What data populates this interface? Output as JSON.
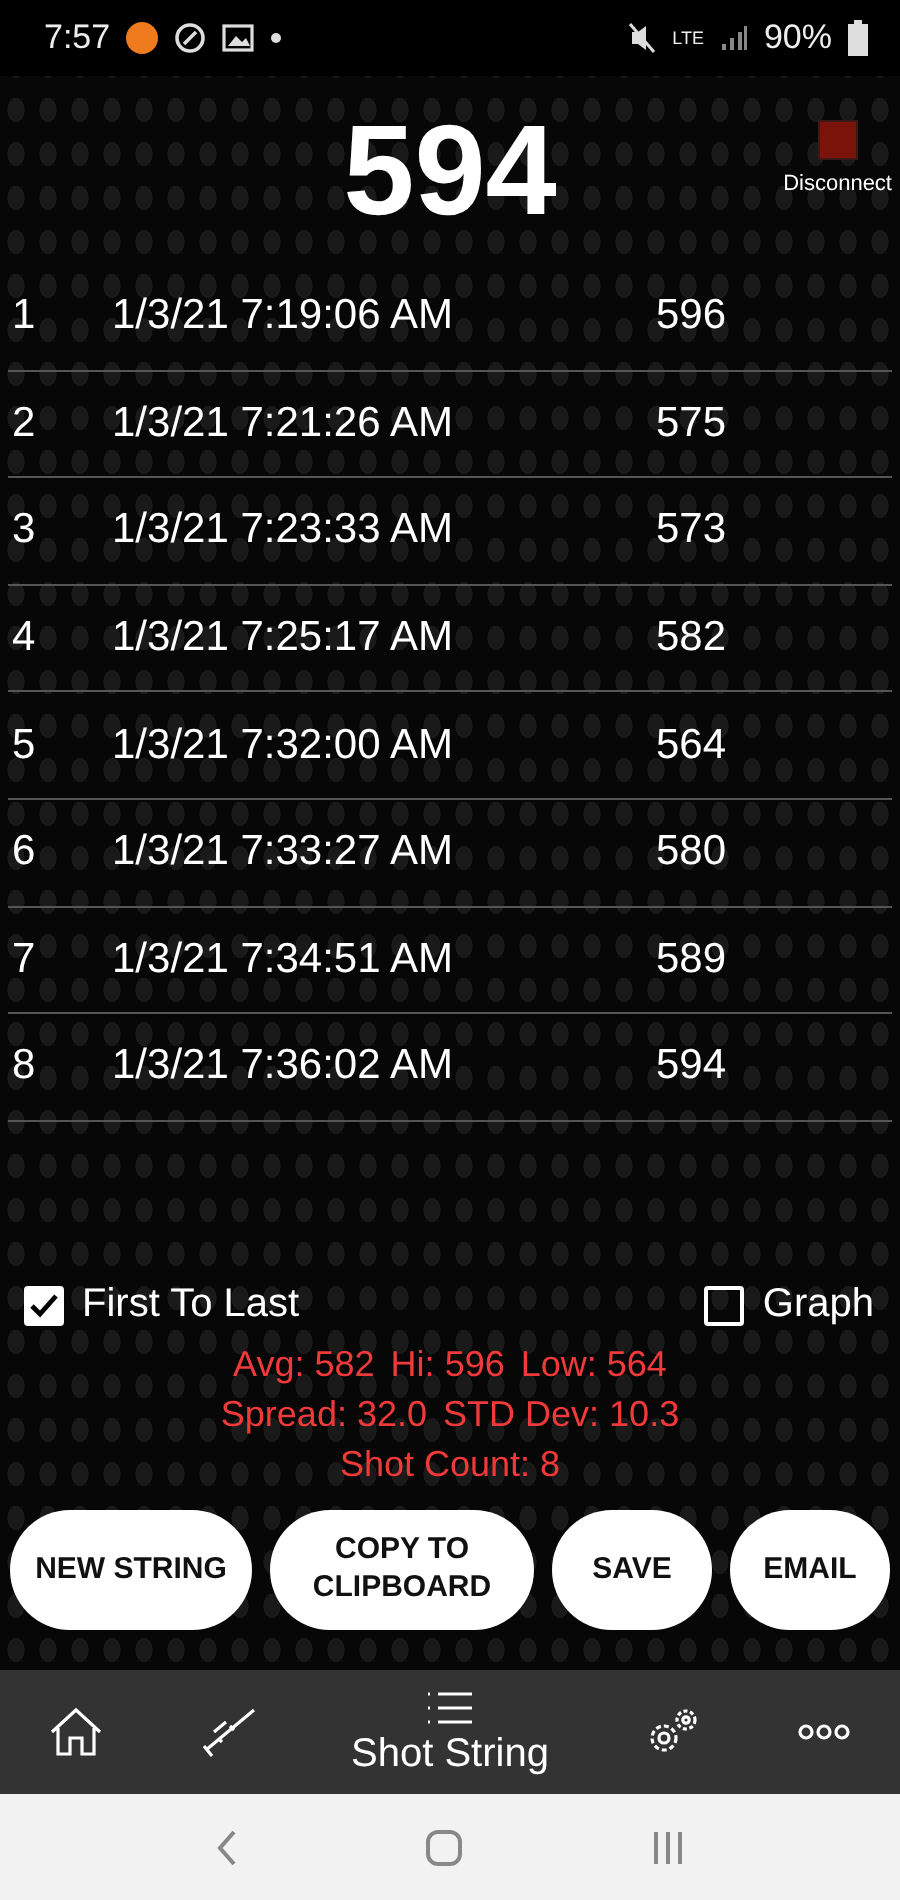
{
  "status_bar": {
    "time": "7:57",
    "network": "LTE",
    "battery": "90%"
  },
  "header": {
    "reading": "594",
    "disconnect": {
      "label": "Disconnect",
      "connected": true
    }
  },
  "shots": [
    {
      "index": "1",
      "time": "1/3/21 7:19:06 AM",
      "velocity": "596"
    },
    {
      "index": "2",
      "time": "1/3/21 7:21:26 AM",
      "velocity": "575"
    },
    {
      "index": "3",
      "time": "1/3/21 7:23:33 AM",
      "velocity": "573"
    },
    {
      "index": "4",
      "time": "1/3/21 7:25:17 AM",
      "velocity": "582"
    },
    {
      "index": "5",
      "time": "1/3/21 7:32:00 AM",
      "velocity": "564"
    },
    {
      "index": "6",
      "time": "1/3/21 7:33:27 AM",
      "velocity": "580"
    },
    {
      "index": "7",
      "time": "1/3/21 7:34:51 AM",
      "velocity": "589"
    },
    {
      "index": "8",
      "time": "1/3/21 7:36:02 AM",
      "velocity": "594"
    }
  ],
  "options": [
    {
      "label": "First To Last",
      "checked": true
    },
    {
      "label": "Graph",
      "checked": false
    }
  ],
  "stats": [
    [
      {
        "label": "Avg:",
        "value": "582"
      },
      {
        "label": "Hi:",
        "value": "596"
      },
      {
        "label": "Low:",
        "value": "564"
      }
    ],
    [
      {
        "label": "Spread:",
        "value": "32.0"
      },
      {
        "label": "STD Dev:",
        "value": "10.3"
      }
    ],
    [
      {
        "label": "Shot Count:",
        "value": "8"
      }
    ]
  ],
  "buttons": [
    {
      "label": "NEW STRING"
    },
    {
      "label": "COPY TO CLIPBOARD"
    },
    {
      "label": "SAVE"
    },
    {
      "label": "EMAIL"
    }
  ],
  "tab_bar": [
    {
      "kind": "home",
      "selected": false
    },
    {
      "kind": "rifle",
      "selected": false
    },
    {
      "kind": "list",
      "selected": true,
      "label": "Shot String"
    },
    {
      "kind": "settings",
      "selected": false
    },
    {
      "kind": "more",
      "selected": false
    }
  ]
}
